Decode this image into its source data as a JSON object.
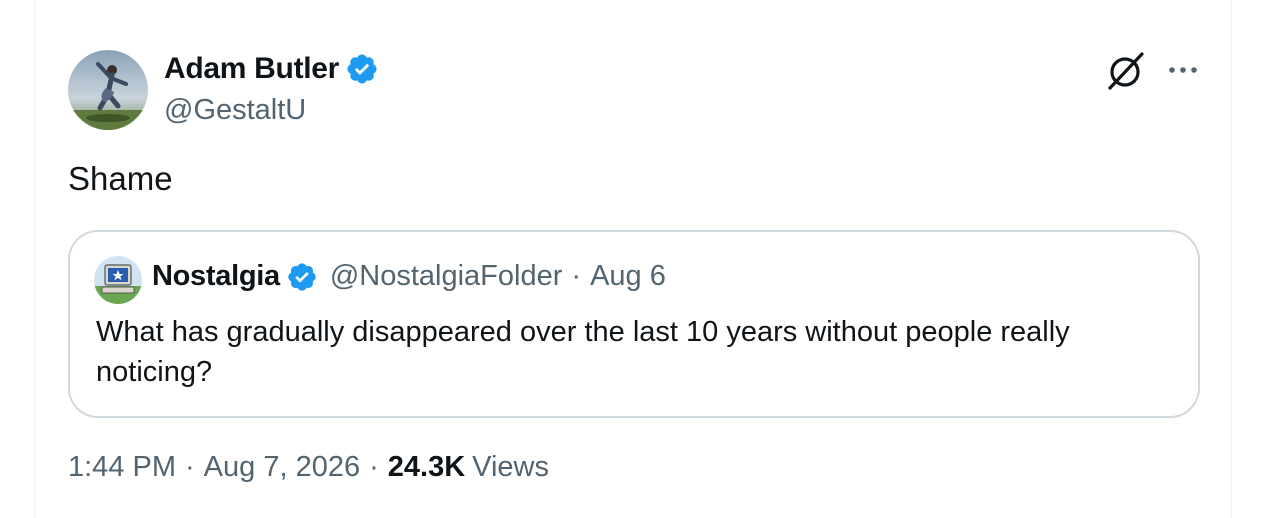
{
  "tweet": {
    "author_name": "Adam Butler",
    "author_handle": "@GestaltU",
    "text": "Shame",
    "time": "1:44 PM",
    "date": "Aug 7, 2026",
    "separator": "·",
    "views_count": "24.3K",
    "views_label": "Views"
  },
  "quoted_tweet": {
    "author_name": "Nostalgia",
    "author_handle": "@NostalgiaFolder",
    "separator": "·",
    "date": "Aug 6",
    "text": "What has gradually disappeared over the last 10 years without people really noticing?"
  },
  "icons": {
    "verified": "verified-badge-icon",
    "grok": "grok-icon",
    "more": "more-options-icon"
  },
  "colors": {
    "verified_blue": "#1d9bf0",
    "secondary_text": "#536471",
    "primary_text": "#0f1419",
    "border": "#cfd9de"
  }
}
